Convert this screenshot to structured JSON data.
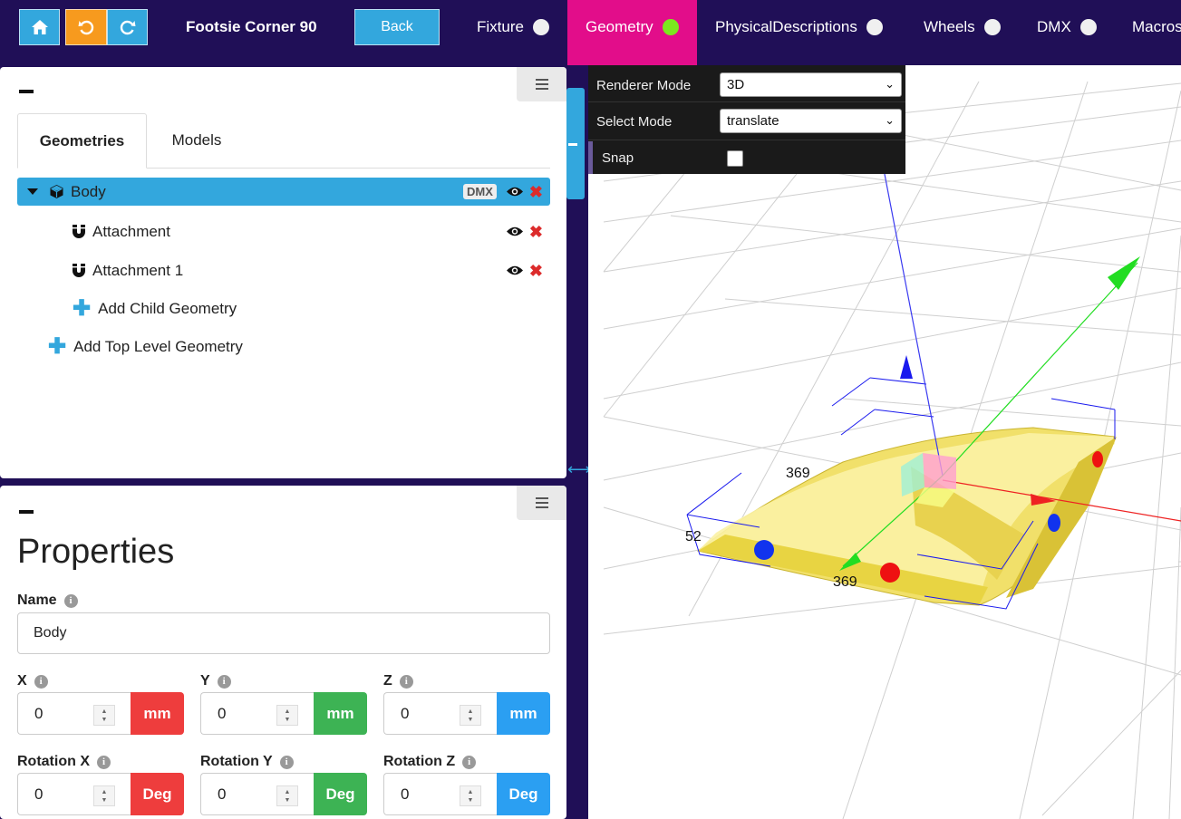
{
  "topbar": {
    "home_icon": "home-icon",
    "undo_icon": "undo-icon",
    "redo_icon": "redo-icon",
    "fixture_name": "Footsie Corner 90",
    "back_label": "Back",
    "tabs": [
      {
        "label": "Fixture",
        "active": false,
        "status": "neutral"
      },
      {
        "label": "Geometry",
        "active": true,
        "status": "ok"
      },
      {
        "label": "PhysicalDescriptions",
        "active": false,
        "status": "neutral"
      },
      {
        "label": "Wheels",
        "active": false,
        "status": "neutral"
      },
      {
        "label": "DMX",
        "active": false,
        "status": "neutral"
      },
      {
        "label": "Macros",
        "active": false,
        "status": "neutral"
      }
    ]
  },
  "tree_panel": {
    "tabs": [
      "Geometries",
      "Models"
    ],
    "rows": [
      {
        "label": "Body",
        "badge": "DMX",
        "icon": "cube-icon",
        "selected": true
      },
      {
        "label": "Attachment",
        "icon": "magnet-icon",
        "selected": false
      },
      {
        "label": "Attachment 1",
        "icon": "magnet-icon",
        "selected": false
      }
    ],
    "add_child": "Add Child Geometry",
    "add_top": "Add Top Level Geometry"
  },
  "properties": {
    "title": "Properties",
    "name_label": "Name",
    "name_value": "Body",
    "position": [
      {
        "label": "X",
        "value": "0",
        "unit": "mm"
      },
      {
        "label": "Y",
        "value": "0",
        "unit": "mm"
      },
      {
        "label": "Z",
        "value": "0",
        "unit": "mm"
      }
    ],
    "rotation": [
      {
        "label": "Rotation X",
        "value": "0",
        "unit": "Deg"
      },
      {
        "label": "Rotation Y",
        "value": "0",
        "unit": "Deg"
      },
      {
        "label": "Rotation Z",
        "value": "0",
        "unit": "Deg"
      }
    ]
  },
  "viewport": {
    "renderer_mode_label": "Renderer Mode",
    "renderer_mode_value": "3D",
    "select_mode_label": "Select Mode",
    "select_mode_value": "translate",
    "snap_label": "Snap",
    "snap_checked": false,
    "dimension_labels": [
      "369",
      "52",
      "369"
    ]
  },
  "colors": {
    "nav_bg": "#200f57",
    "active_tab": "#e20d8a",
    "accent_blue": "#33a7dd",
    "undo_orange": "#f79a1e",
    "status_ok": "#7be81e",
    "axis_x": "#ee3d3d",
    "axis_y": "#3db354",
    "axis_z": "#2b9ff2"
  }
}
